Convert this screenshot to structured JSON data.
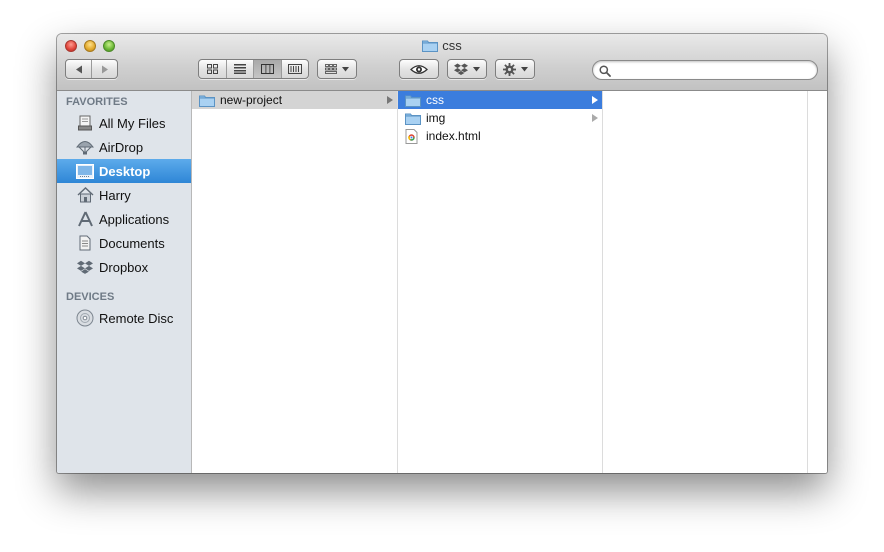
{
  "window": {
    "title": "css"
  },
  "toolbar": {
    "back_icon": "back-arrow-icon",
    "forward_icon": "forward-arrow-icon",
    "view_modes": [
      "icon-view",
      "list-view",
      "column-view",
      "cover-flow-view"
    ],
    "active_view": "column-view",
    "search": {
      "value": "",
      "placeholder": ""
    }
  },
  "sidebar": {
    "favorites_header": "FAVORITES",
    "favorites": [
      {
        "label": "All My Files",
        "icon": "all-my-files-icon"
      },
      {
        "label": "AirDrop",
        "icon": "airdrop-icon"
      },
      {
        "label": "Desktop",
        "icon": "desktop-icon",
        "selected": true
      },
      {
        "label": "Harry",
        "icon": "home-icon"
      },
      {
        "label": "Applications",
        "icon": "applications-icon"
      },
      {
        "label": "Documents",
        "icon": "documents-icon"
      },
      {
        "label": "Dropbox",
        "icon": "dropbox-icon"
      }
    ],
    "devices_header": "DEVICES",
    "devices": [
      {
        "label": "Remote Disc",
        "icon": "disc-icon"
      }
    ]
  },
  "columns": [
    {
      "items": [
        {
          "name": "new-project",
          "type": "folder",
          "selected": "inactive"
        }
      ]
    },
    {
      "items": [
        {
          "name": "css",
          "type": "folder",
          "selected": "active"
        },
        {
          "name": "img",
          "type": "folder"
        },
        {
          "name": "index.html",
          "type": "html-file"
        }
      ]
    },
    {
      "items": []
    }
  ],
  "colors": {
    "selection_active": "#3b7ddd",
    "selection_inactive": "#d4d4d4",
    "sidebar_selection": "#2e86d6",
    "sidebar_bg": "#dfe4ea"
  }
}
